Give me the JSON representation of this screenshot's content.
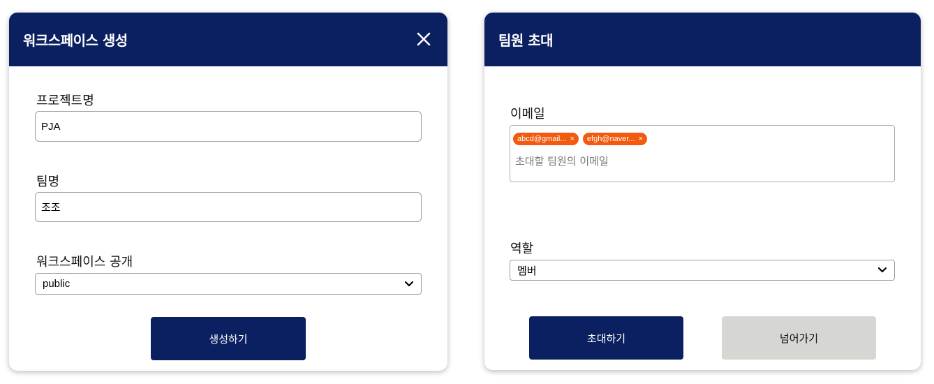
{
  "workspace_card": {
    "title": "워크스페이스 생성",
    "project_label": "프로젝트명",
    "project_value": "PJA",
    "team_label": "팀명",
    "team_value": "조조",
    "visibility_label": "워크스페이스 공개",
    "visibility_value": "public",
    "create_button": "생성하기"
  },
  "invite_card": {
    "title": "팀원 초대",
    "email_label": "이메일",
    "email_tags": [
      "abcd@gmail...",
      "efgh@naver..."
    ],
    "tag_remove": "×",
    "email_placeholder": "초대할 팀원의 이메일",
    "role_label": "역할",
    "role_value": "멤버",
    "invite_button": "초대하기",
    "skip_button": "넘어가기"
  },
  "colors": {
    "header": "#0b2060",
    "tag": "#f25a10",
    "secondary_button": "#d6d6d3"
  },
  "icons": {
    "close": "close-icon",
    "dropdown": "chevron-down-icon"
  }
}
